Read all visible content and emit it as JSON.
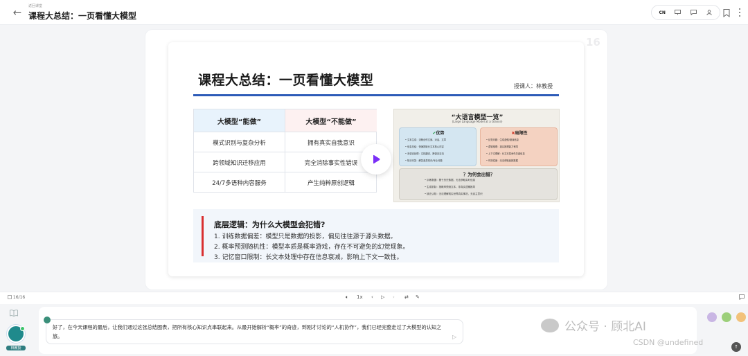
{
  "header": {
    "breadcrumb": "返回课堂",
    "title": "课程大总结：一页看懂大模型",
    "lang_label": "CN"
  },
  "stage": {
    "page_watermark": "16"
  },
  "slide": {
    "title": "课程大总结：一页看懂大模型",
    "teacher": "授课人：林教授",
    "table": {
      "col_left": "大模型“能做”",
      "col_right": "大模型“不能做”",
      "rows": [
        {
          "left": "模式识别与复杂分析",
          "right": "拥有真实自我意识"
        },
        {
          "left": "跨领域知识迁移应用",
          "right": "完全消除事实性错误"
        },
        {
          "left": "24/7多语种内容服务",
          "right": "产生纯粹原创逻辑"
        }
      ]
    },
    "infographic": {
      "title": "“大语言模型一览”",
      "subtitle": "(Large Language Model at a Glance)",
      "adv_head": "优势",
      "adv_mark": "✔",
      "adv_items": [
        "• 文本生成：流畅创作文案、对话、文章",
        "• 信息总结：快速提取长文本核心内容",
        "• 多语言处理：文档翻译、跨语言交流",
        "• 知识问答：解答各类常识/专业问题"
      ],
      "lim_head": "局限性",
      "lim_mark": "✖",
      "lim_items": [
        "• 幻觉问题：生成虚假/错误信息",
        "• 逻辑推理：複杂推理能力有限",
        "• 上下文理解：长文本易丢失关键信息",
        "• 时效性差：无法获取最新数据"
      ],
      "why_head": "？为何会出错？",
      "why_items": [
        "• 训练数据：基于历史数据，无法获取实时信息",
        "• 生成机制：按概率预测文本，非真实逻辑推导",
        "• 缺乏认知：无法理解现实世界真实情况，无自主意识"
      ]
    },
    "reason": {
      "heading": "底层逻辑：为什么大模型会犯错?",
      "lines": [
        "1. 训练数据偏差：模型只是数据的投影，偏见往往源于源头数据。",
        "2. 概率预测随机性：模型本质是概率游戏，存在不可避免的幻觉现象。",
        "3. 记忆窗口限制：长文本处理中存在信息衰减，影响上下文一致性。"
      ]
    }
  },
  "playback": {
    "counter": "16/16",
    "speed": "1x"
  },
  "teacher": {
    "name": "林教授"
  },
  "subtitle": {
    "text": "好了，在今天课程的最后，让我们通过这张总结图表，把所有核心知识点串联起来。从最开始解析“概率”的奇迹，到刚才讨论的“人机协作”，我们已经完整走过了大模型的认知之旅。"
  },
  "watermark": {
    "line1": "公众号 · 顾北AI",
    "line2": "CSDN @undefined"
  },
  "colors": {
    "accent_blue": "#2d5bb8",
    "play_purple": "#7b2ff7",
    "reason_red": "#d92f2f"
  }
}
